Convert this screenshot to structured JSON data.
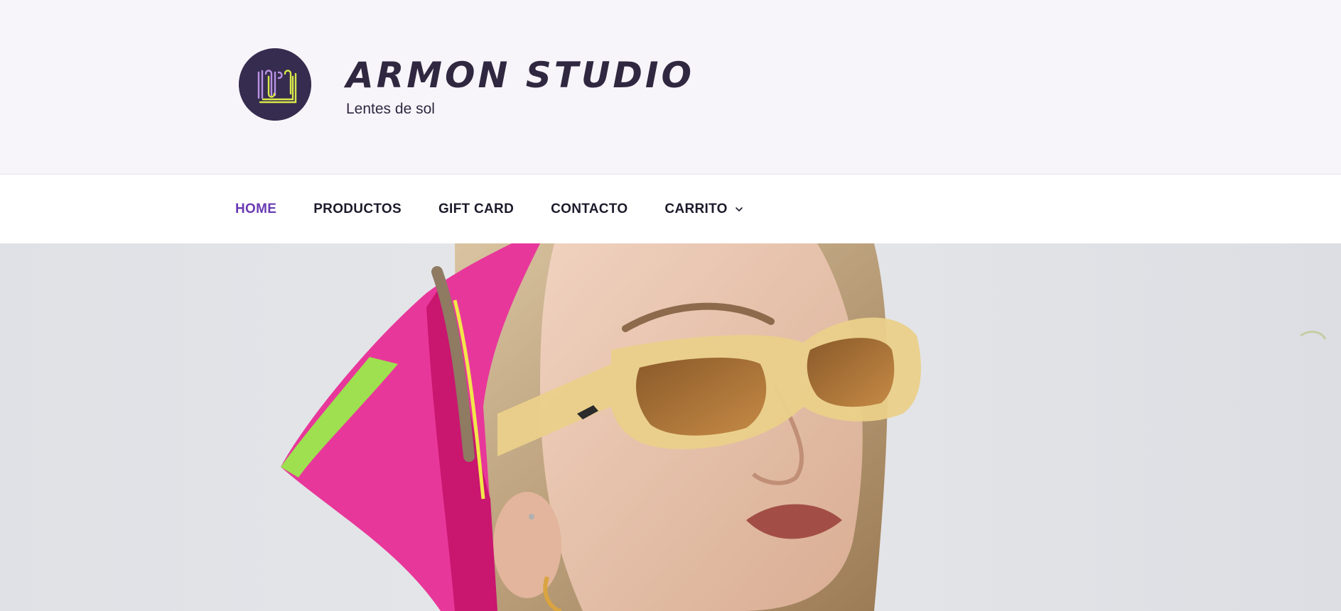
{
  "site": {
    "title": "ARMON STUDIO",
    "tagline": "Lentes de sol",
    "logo_icon": "armon-monogram-logo",
    "colors": {
      "header_bg": "#f7f5fa",
      "brand_dark": "#362c4f",
      "logo_accent_purple": "#b993e6",
      "logo_accent_yellow": "#d9e84a",
      "nav_active": "#6a3bb3",
      "nav_text": "#1e1a2b"
    }
  },
  "nav": {
    "items": [
      {
        "label": "HOME",
        "active": true
      },
      {
        "label": "PRODUCTOS",
        "active": false
      },
      {
        "label": "GIFT CARD",
        "active": false
      },
      {
        "label": "CONTACTO",
        "active": false
      },
      {
        "label": "CARRITO",
        "active": false,
        "icon": "chevron-down-icon"
      }
    ]
  },
  "hero": {
    "image": "woman-with-pink-headscarf-and-yellow-sunglasses"
  }
}
